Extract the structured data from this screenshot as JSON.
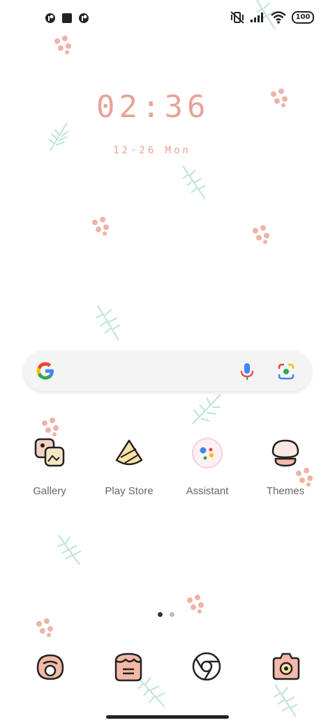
{
  "status_bar": {
    "battery": "100",
    "icons_left": [
      "notification-icon-1",
      "stop-icon",
      "notification-icon-2"
    ],
    "icons_right": [
      "vibrate-mute-icon",
      "signal-icon",
      "wifi-icon",
      "battery-icon"
    ]
  },
  "clock": {
    "time": "02:36",
    "date": "12·26 Mon"
  },
  "search": {
    "icons": [
      "google-g-icon",
      "mic-icon",
      "lens-icon"
    ]
  },
  "apps": [
    {
      "label": "Gallery",
      "icon": "gallery-icon"
    },
    {
      "label": "Play Store",
      "icon": "play-store-icon"
    },
    {
      "label": "Assistant",
      "icon": "assistant-icon"
    },
    {
      "label": "Themes",
      "icon": "themes-icon"
    }
  ],
  "dock": [
    {
      "icon": "phone-icon"
    },
    {
      "icon": "messages-icon"
    },
    {
      "icon": "chrome-icon"
    },
    {
      "icon": "camera-icon"
    }
  ],
  "page_indicator": {
    "pages": 2,
    "current": 1
  },
  "colors": {
    "accent_pink": "#e7a396",
    "leaf_mint": "#bfe3d3",
    "dot_active": "#333333",
    "dot_inactive": "#bbbbbb"
  }
}
